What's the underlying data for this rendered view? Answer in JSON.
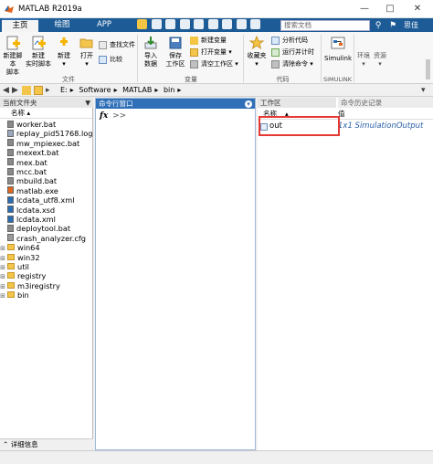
{
  "window": {
    "title": "MATLAB R2019a"
  },
  "tabs": [
    {
      "label": "主页"
    },
    {
      "label": "绘图"
    },
    {
      "label": "APP"
    }
  ],
  "search": {
    "placeholder": "搜索文档"
  },
  "user": {
    "name": "思佳"
  },
  "ribbon": {
    "new_script": "新建脚本",
    "new_script_2": "脚本",
    "new_live_script": "新建",
    "new_live_script_2": "实时脚本",
    "new": "新建",
    "open": "打开",
    "find_files": "查找文件",
    "compare": "比较",
    "import_data": "导入",
    "import_data_2": "数据",
    "save_workspace": "保存",
    "save_workspace_2": "工作区",
    "new_variable": "新建变量",
    "open_variable": "打开变量",
    "clear_workspace": "清空工作区",
    "favorites": "收藏夹",
    "analyze_code": "分析代码",
    "run_and_time": "运行并计时",
    "clear_commands": "清除命令",
    "simulink": "Simulink",
    "environment": "环境",
    "resources": "资源",
    "group_file": "文件",
    "group_variable": "变量",
    "group_code": "代码",
    "group_simulink": "SIMULINK"
  },
  "address": {
    "parts": [
      "E:",
      "Software",
      "MATLAB",
      "bin"
    ]
  },
  "current_folder": {
    "title": "当前文件夹",
    "column_name": "名称",
    "files": [
      {
        "name": "worker.bat",
        "type": "bat"
      },
      {
        "name": "replay_pid51768.log",
        "type": "log"
      },
      {
        "name": "mw_mpiexec.bat",
        "type": "bat"
      },
      {
        "name": "mexext.bat",
        "type": "bat"
      },
      {
        "name": "mex.bat",
        "type": "bat"
      },
      {
        "name": "mcc.bat",
        "type": "bat"
      },
      {
        "name": "mbuild.bat",
        "type": "bat"
      },
      {
        "name": "matlab.exe",
        "type": "exe"
      },
      {
        "name": "lcdata_utf8.xml",
        "type": "xml"
      },
      {
        "name": "lcdata.xsd",
        "type": "xml"
      },
      {
        "name": "lcdata.xml",
        "type": "xml"
      },
      {
        "name": "deploytool.bat",
        "type": "bat"
      },
      {
        "name": "crash_analyzer.cfg",
        "type": "cfg"
      },
      {
        "name": "win64",
        "type": "folder"
      },
      {
        "name": "win32",
        "type": "folder"
      },
      {
        "name": "util",
        "type": "folder"
      },
      {
        "name": "registry",
        "type": "folder"
      },
      {
        "name": "m3iregistry",
        "type": "folder"
      },
      {
        "name": "bin",
        "type": "folder"
      }
    ],
    "details": "详细信息"
  },
  "command_window": {
    "title": "命令行窗口",
    "prompt": ">>",
    "fx": "fx"
  },
  "workspace": {
    "title": "工作区",
    "history_tab": "命令历史记录",
    "column_name": "名称",
    "column_value": "值",
    "variables": [
      {
        "name": "out",
        "value": "1x1 SimulationOutput"
      }
    ]
  },
  "colors": {
    "tab_bar": "#1c5b96",
    "active_panel_header": "#2f6fb8",
    "highlight_box": "#e53935",
    "value_text": "#2b5fa6"
  }
}
